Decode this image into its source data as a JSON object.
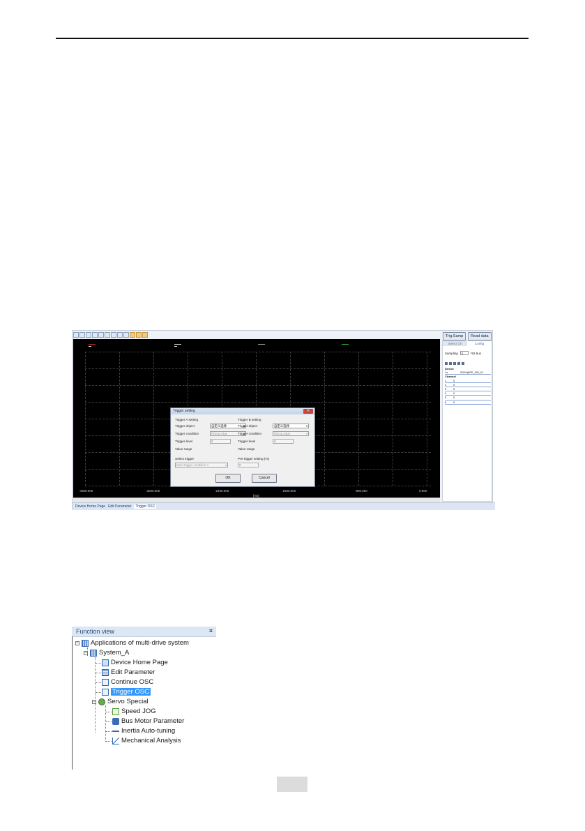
{
  "osc": {
    "buttons": {
      "trig_samp": "Trig.Samp",
      "read_data": "Read data"
    },
    "x_ticks": [
      "-4000.000",
      "-3200.000",
      "-2400.000",
      "-1600.000",
      "-800.000",
      "0.000"
    ],
    "x_unit": "[ms]",
    "legend_colors": [
      "#b03030",
      "#cfcfcf",
      "#9a9a9a",
      "#2faa2f"
    ],
    "right_panel": {
      "tabs": [
        "Select Ch",
        "Config"
      ],
      "sampling_label": "Sampling",
      "sampling_value": "1",
      "sampling_unit": "*62.5us",
      "device_label": "Device",
      "device_row": {
        "col1": "1s",
        "col3": "200V@FE_IS6_IS"
      },
      "channel_label": "Channel",
      "channels": [
        "1",
        "2",
        "3",
        "4",
        "5",
        "6"
      ],
      "channel_value": "0"
    },
    "tabs": [
      "Device Home Page",
      "Edit Parameter",
      "Trigger OSC"
    ],
    "dialog": {
      "title": "Trigger setting",
      "close": "✕",
      "a_heading": "Trigger A setting",
      "b_heading": "Trigger B setting",
      "trigger_object": "Trigger object",
      "trigger_object_value": "自定义选择",
      "trigger_condition": "Trigger condition",
      "trigger_condition_value": "Rising edge",
      "trigger_level": "Trigger level",
      "trigger_level_value": "0",
      "value_range": "Value range",
      "select_trigger": "Select trigger",
      "select_trigger_value": "Meet trigger condition A",
      "pre_trigger": "Pre-trigger setting (%)",
      "pre_trigger_value": "0",
      "ok": "OK",
      "cancel": "Cancel"
    }
  },
  "function_view": {
    "title": "Function view",
    "pin": "ㅍ",
    "root": "Applications of multi-drive system",
    "system": "System_A",
    "items": [
      "Device Home Page",
      "Edit Parameter",
      "Continue OSC",
      "Trigger OSC"
    ],
    "servo": "Servo Special",
    "servo_items": [
      "Speed JOG",
      "Bus Motor Parameter",
      "Inertia Auto-tuning",
      "Mechanical Analysis"
    ]
  }
}
